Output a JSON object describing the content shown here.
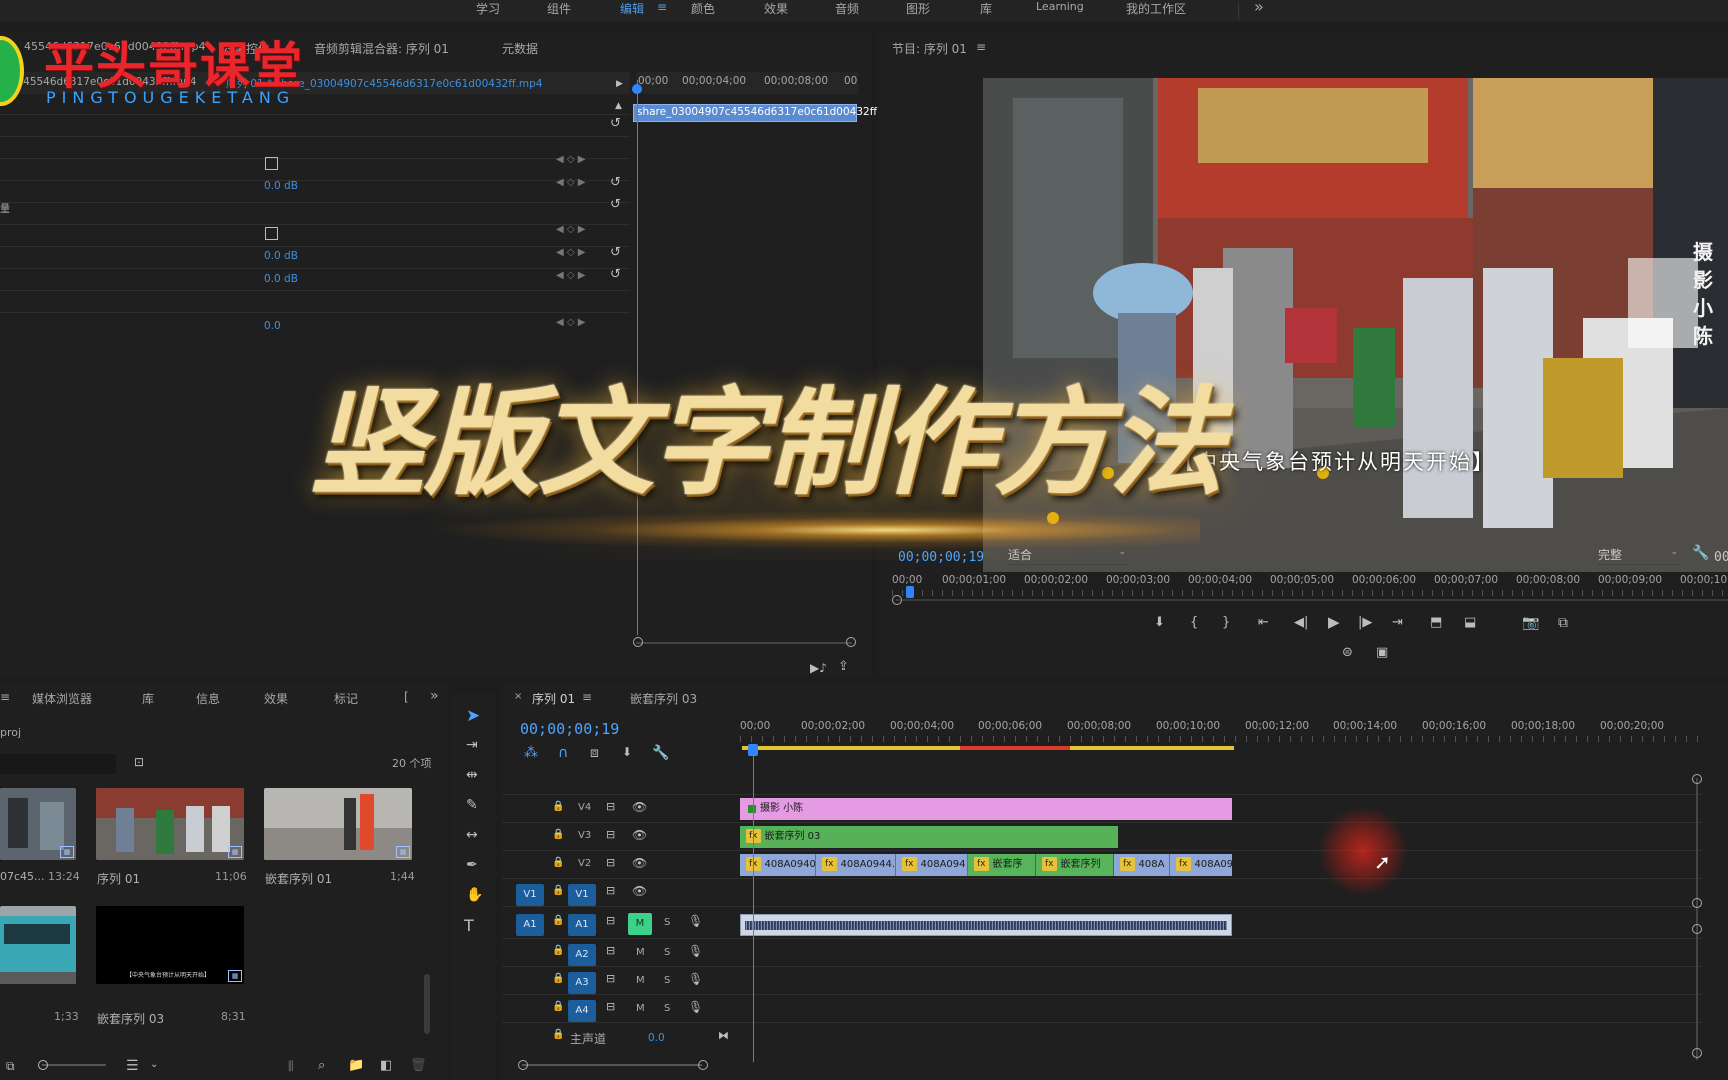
{
  "workspaces": {
    "tabs": [
      "学习",
      "组件",
      "编辑",
      "颜色",
      "效果",
      "音频",
      "图形",
      "库",
      "Learning",
      "我的工作区"
    ],
    "active": "编辑",
    "overflow": "»"
  },
  "watermark": {
    "title": "平头哥课堂",
    "subtitle": "PINGTOUGEKETANG"
  },
  "overlay_title": "竖版文字制作方法",
  "source_panel": {
    "clip_name": "45546d6317e0c61d00432ff.mp4",
    "tabs": [
      "效果控件",
      "音频剪辑混合器: 序列 01",
      "元数据"
    ],
    "path_left": "07c45546d6317e0c61d00432ff.mp4",
    "path_right": "序列 01 * share_03004907c45546d6317e0c61d00432ff.mp4",
    "ruler": [
      "00;00",
      "00;00;04;00",
      "00;00;08;00",
      "00"
    ],
    "clip_label": "share_03004907c45546d6317e0c61d00432ff",
    "rows": [
      {
        "value": ""
      },
      {
        "value": "0.0 dB"
      },
      {
        "value": ""
      },
      {
        "value": ""
      },
      {
        "value": "0.0 dB"
      },
      {
        "value": "0.0 dB"
      },
      {
        "value": ""
      },
      {
        "value": "0.0"
      }
    ],
    "side_glyph": "量"
  },
  "program_monitor": {
    "title": "节目: 序列 01",
    "timecode": "00;00;00;19",
    "fit": "适合",
    "quality": "完整",
    "subtitle": "【中央气象台预计从明天开始】",
    "vertical_sign": "摄影小陈",
    "ruler": [
      "00;00",
      "00;00;01;00",
      "00;00;02;00",
      "00;00;03;00",
      "00;00;04;00",
      "00;00;05;00",
      "00;00;06;00",
      "00;00;07;00",
      "00;00;08;00",
      "00;00;09;00",
      "00;00;10"
    ],
    "end_tc": "00"
  },
  "project_panel": {
    "tabs": [
      "媒体浏览器",
      "库",
      "信息",
      "效果",
      "标记"
    ],
    "project_name": "proj",
    "item_count": "20 个项",
    "items": [
      {
        "name": "07c45...",
        "duration": "13:24"
      },
      {
        "name": "序列 01",
        "duration": "11;06"
      },
      {
        "name": "嵌套序列 01",
        "duration": "1;44"
      },
      {
        "name": "",
        "duration": "1;33"
      },
      {
        "name": "嵌套序列 03",
        "duration": "8;31"
      }
    ],
    "black_caption": "【中央气象台预计从明天开始】"
  },
  "timeline": {
    "tabs": [
      "序列 01",
      "嵌套序列 03"
    ],
    "timecode": "00;00;00;19",
    "ruler": [
      "00;00",
      "00;00;02;00",
      "00;00;04;00",
      "00;00;06;00",
      "00;00;08;00",
      "00;00;10;00",
      "00;00;12;00",
      "00;00;14;00",
      "00;00;16;00",
      "00;00;18;00",
      "00;00;20;00"
    ],
    "video_tracks": [
      "V4",
      "V3",
      "V2",
      "V1"
    ],
    "audio_tracks": [
      "A1",
      "A2",
      "A3",
      "A4"
    ],
    "source_v": "V1",
    "source_a": "A1",
    "master": {
      "label": "主声道",
      "value": "0.0"
    },
    "clips": {
      "v4": "摄影 小陈",
      "v3": "嵌套序列 03",
      "v2": [
        "408A0940.",
        "408A0944.",
        "408A094",
        "嵌套序",
        "嵌套序列",
        "408A",
        "408A09"
      ]
    },
    "colors": {
      "v4": "#e59be4",
      "v3": "#56b158",
      "v2": "#8fa6d8",
      "nested": "#57b45b",
      "playhead": "#2f86ff"
    }
  }
}
